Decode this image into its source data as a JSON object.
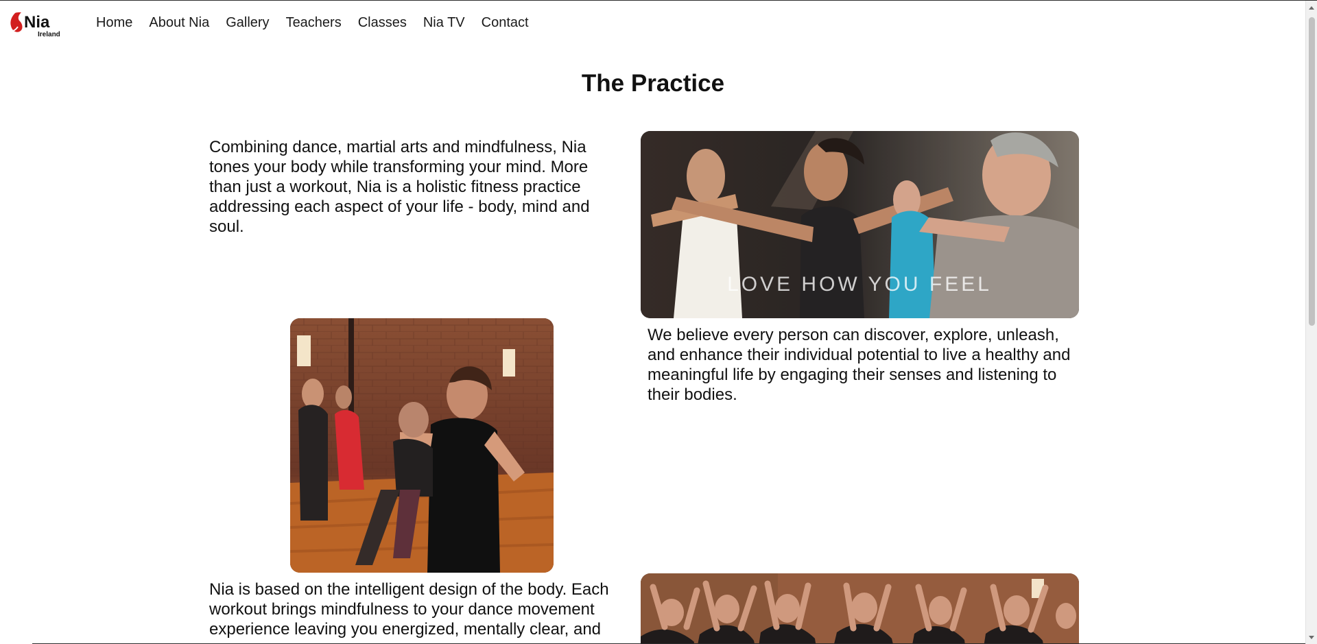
{
  "header": {
    "logo_text": "Nia",
    "logo_subtext": "Ireland",
    "nav": [
      "Home",
      "About Nia",
      "Gallery",
      "Teachers",
      "Classes",
      "Nia TV",
      "Contact"
    ]
  },
  "main": {
    "title": "The Practice",
    "paragraphs": [
      "Combining dance, martial arts and mindfulness, Nia tones your body while transforming your mind. More than just a workout, Nia is a holistic fitness practice addressing each aspect of your life - body, mind and soul.",
      "We believe every person can discover, explore, unleash, and enhance their individual potential to live a healthy and meaningful life by engaging their senses and listening to their bodies.",
      "Nia is based on the intelligent design of the body. Each workout brings mindfulness to your dance movement experience leaving you energized, mentally clear, and"
    ],
    "photo_caption": "LOVE HOW YOU FEEL"
  },
  "colors": {
    "background": "#ffffff",
    "text": "#111111",
    "logo_red": "#d21f1f",
    "scroll_thumb": "#c1c1c1"
  }
}
